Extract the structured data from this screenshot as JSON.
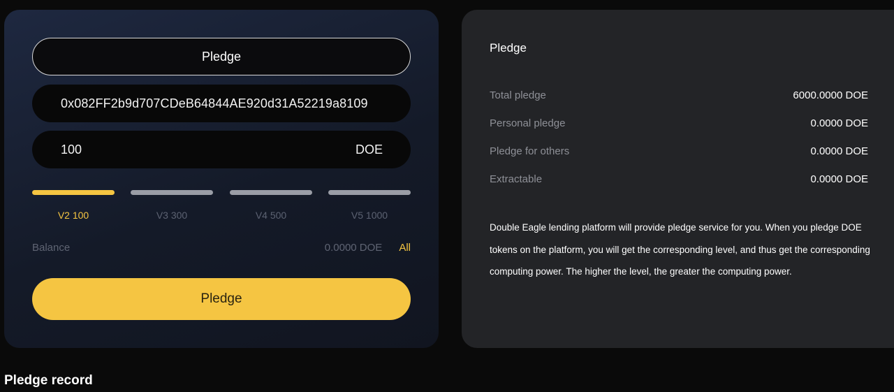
{
  "form": {
    "mode_label": "Pledge",
    "address": "0x082FF2b9d707CDeB64844AE920d31A52219a8109",
    "amount": "100",
    "unit": "DOE",
    "levels": [
      {
        "label": "V2 100",
        "active": true
      },
      {
        "label": "V3 300",
        "active": false
      },
      {
        "label": "V4 500",
        "active": false
      },
      {
        "label": "V5 1000",
        "active": false
      }
    ],
    "balance_label": "Balance",
    "balance_value": "0.0000 DOE",
    "all_label": "All",
    "submit_label": "Pledge"
  },
  "info": {
    "title": "Pledge",
    "stats": [
      {
        "label": "Total pledge",
        "value": "6000.0000 DOE"
      },
      {
        "label": "Personal pledge",
        "value": "0.0000 DOE"
      },
      {
        "label": "Pledge for others",
        "value": "0.0000 DOE"
      },
      {
        "label": "Extractable",
        "value": "0.0000 DOE"
      }
    ],
    "description": "Double Eagle lending platform will provide pledge service for you. When you pledge DOE tokens on the platform, you will get the corresponding level, and thus get the corresponding computing power. The higher the level, the greater the computing power."
  },
  "records": {
    "title": "Pledge record"
  },
  "colors": {
    "accent": "#f5c542",
    "background": "#0a0a0a",
    "card_right": "#232427"
  }
}
